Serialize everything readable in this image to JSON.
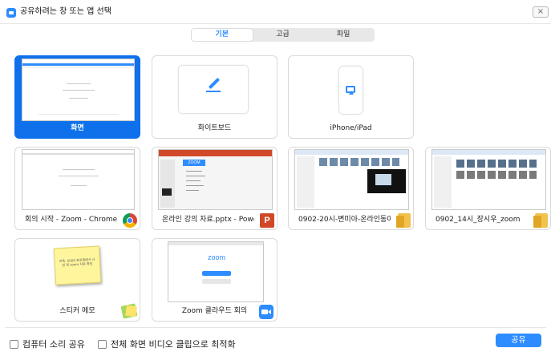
{
  "window": {
    "title": "공유하려는 창 또는 앱 선택",
    "close_glyph": "×"
  },
  "tabs": [
    {
      "label": "기본",
      "active": true
    },
    {
      "label": "고급",
      "active": false
    },
    {
      "label": "파일",
      "active": false
    }
  ],
  "tiles": {
    "screen": {
      "label": "화면"
    },
    "whiteboard": {
      "label": "화이트보드"
    },
    "iphone": {
      "label": "iPhone/iPad"
    },
    "chrome": {
      "label": "회의 시작 - Zoom - Chrome"
    },
    "ppt": {
      "label": "온라인 강의 자료.pptx - PowerPo...",
      "icon_text": "P",
      "thumb_title": "ZOOM"
    },
    "folder1": {
      "label": "0902-20시-변미아-온라인동아리..."
    },
    "folder2": {
      "label": "0902_14시_장시우_zoom"
    },
    "sticky": {
      "label": "스티커 메모",
      "note_text": "카톡: 0000 프로필에서 사진 및 zoom 자료 확인"
    },
    "zoom": {
      "label": "Zoom 클라우드 회의",
      "thumb_logo": "zoom"
    }
  },
  "footer": {
    "computer_sound": "컴퓨터 소리 공유",
    "optimize_video": "전체 화면 비디오 클립으로 최적화",
    "share_button": "공유"
  },
  "colors": {
    "accent": "#2d8cff",
    "selected": "#0e71eb"
  }
}
